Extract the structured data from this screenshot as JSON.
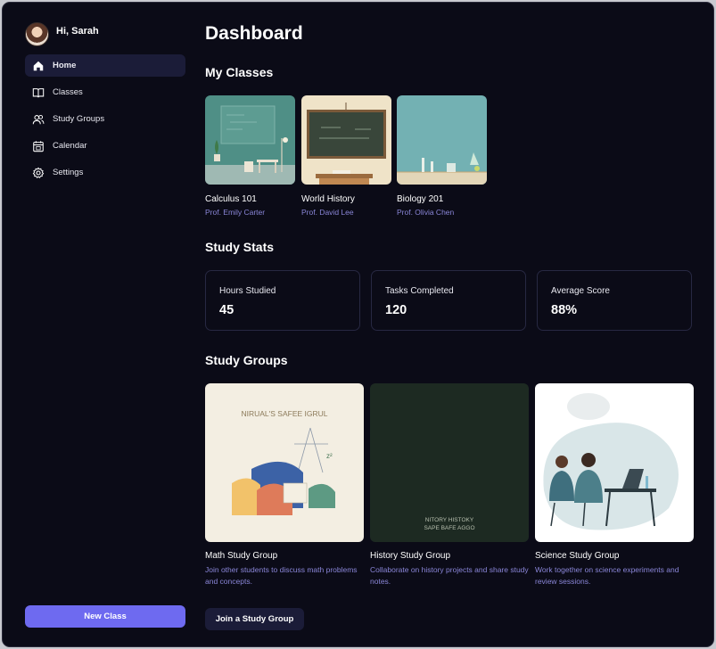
{
  "user": {
    "greeting": "Hi, Sarah"
  },
  "sidebar": {
    "items": [
      {
        "label": "Home",
        "icon": "home-icon",
        "active": true
      },
      {
        "label": "Classes",
        "icon": "book-icon",
        "active": false
      },
      {
        "label": "Study Groups",
        "icon": "users-icon",
        "active": false
      },
      {
        "label": "Calendar",
        "icon": "calendar-icon",
        "active": false
      },
      {
        "label": "Settings",
        "icon": "gear-icon",
        "active": false
      }
    ],
    "new_class_label": "New Class"
  },
  "main": {
    "title": "Dashboard",
    "my_classes_title": "My Classes",
    "classes": [
      {
        "name": "Calculus 101",
        "professor": "Prof. Emily Carter"
      },
      {
        "name": "World History",
        "professor": "Prof. David Lee"
      },
      {
        "name": "Biology 201",
        "professor": "Prof. Olivia Chen"
      }
    ],
    "study_stats_title": "Study Stats",
    "stats": [
      {
        "label": "Hours Studied",
        "value": "45"
      },
      {
        "label": "Tasks Completed",
        "value": "120"
      },
      {
        "label": "Average Score",
        "value": "88%"
      }
    ],
    "study_groups_title": "Study Groups",
    "groups": [
      {
        "name": "Math Study Group",
        "description": "Join other students to discuss math problems and concepts.",
        "image_text": "NIRUAL'S SAFEE IGRUL"
      },
      {
        "name": "History Study Group",
        "description": "Collaborate on history projects and share study notes.",
        "image_text_1": "NITORY HISTOKY",
        "image_text_2": "SAPE BAFE AGGO"
      },
      {
        "name": "Science Study Group",
        "description": "Work together on science experiments and review sessions."
      }
    ],
    "join_label": "Join a Study Group"
  },
  "colors": {
    "background": "#0b0b17",
    "accent": "#6e6af0",
    "active_nav": "#1b1c38",
    "subtext": "#8a86d8"
  }
}
